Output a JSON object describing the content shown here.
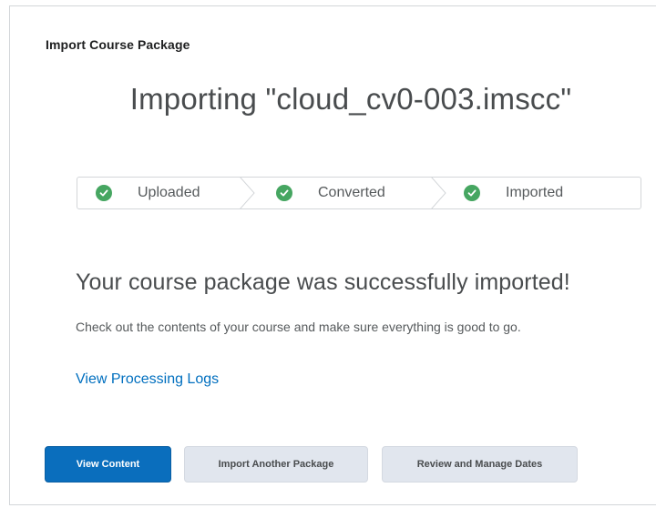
{
  "dialog": {
    "title": "Import Course Package",
    "import_heading": "Importing \"cloud_cv0-003.imscc\""
  },
  "stepper": {
    "steps": [
      {
        "label": "Uploaded",
        "status": "complete",
        "icon": "check-circle-icon"
      },
      {
        "label": "Converted",
        "status": "complete",
        "icon": "check-circle-icon"
      },
      {
        "label": "Imported",
        "status": "complete",
        "icon": "check-circle-icon"
      }
    ],
    "separator_icon": "chevron-right-icon"
  },
  "result": {
    "heading": "Your course package was successfully imported!",
    "body": "Check out the contents of your course and make sure everything is good to go.",
    "logs_link": "View Processing Logs"
  },
  "actions": {
    "view_content": "View Content",
    "import_another": "Import Another Package",
    "review_dates": "Review and Manage Dates"
  },
  "colors": {
    "primary": "#0a6ebd",
    "success": "#46a661",
    "link": "#006fbf",
    "secondary_button": "#e1e6ee"
  }
}
